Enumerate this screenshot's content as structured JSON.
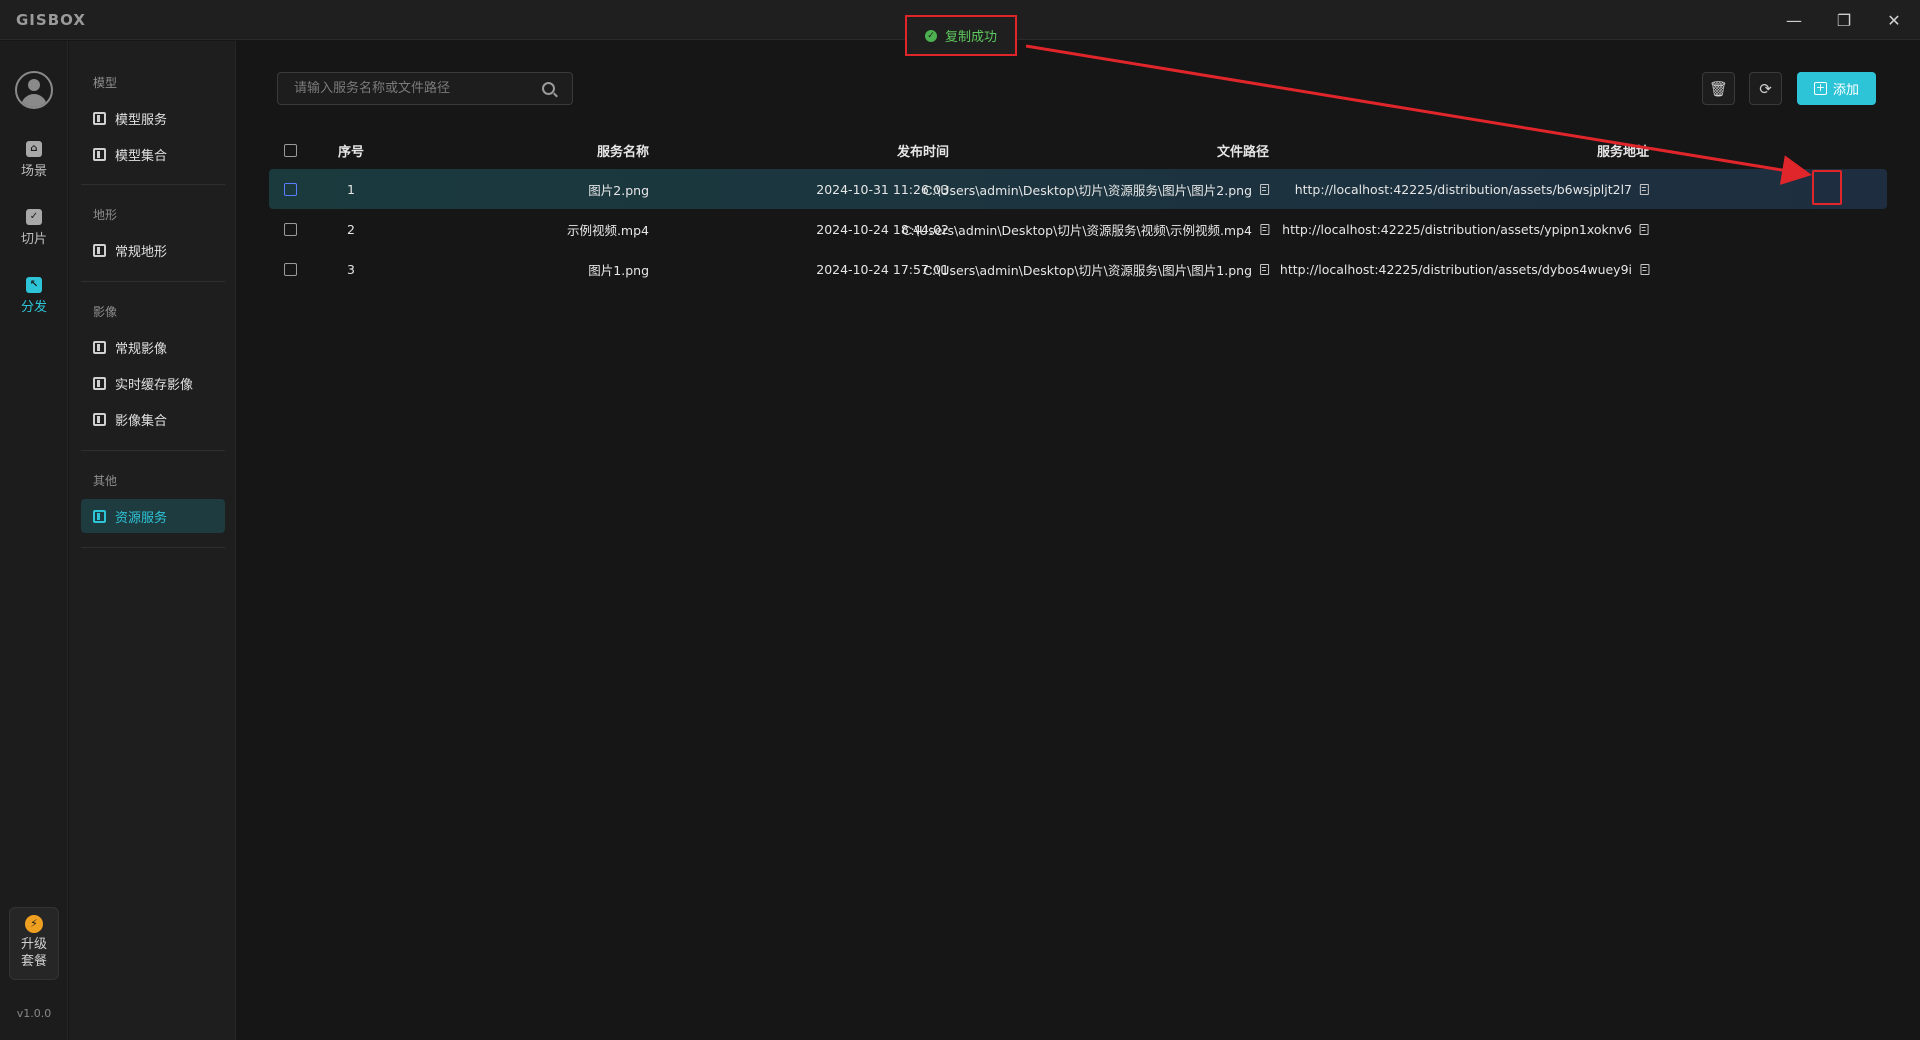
{
  "app": {
    "logo": "GISBOX"
  },
  "window_controls": {
    "minimize": "—",
    "maximize": "❐",
    "close": "✕"
  },
  "toast": {
    "text": "复制成功",
    "status_color": "#4caf50"
  },
  "rail": {
    "items": [
      {
        "label": "场景",
        "icon": "home-icon",
        "active": false
      },
      {
        "label": "切片",
        "icon": "check-square-icon",
        "active": false
      },
      {
        "label": "分发",
        "icon": "share-icon",
        "active": true
      }
    ],
    "upgrade": {
      "line1": "升级",
      "line2": "套餐"
    },
    "version": "v1.0.0"
  },
  "menu": {
    "sections": [
      {
        "title": "模型",
        "items": [
          {
            "label": "模型服务"
          },
          {
            "label": "模型集合"
          }
        ]
      },
      {
        "title": "地形",
        "items": [
          {
            "label": "常规地形"
          }
        ]
      },
      {
        "title": "影像",
        "items": [
          {
            "label": "常规影像"
          },
          {
            "label": "实时缓存影像"
          },
          {
            "label": "影像集合"
          }
        ]
      },
      {
        "title": "其他",
        "items": [
          {
            "label": "资源服务",
            "active": true
          }
        ]
      }
    ]
  },
  "toolbar": {
    "search_placeholder": "请输入服务名称或文件路径",
    "add_label": "添加",
    "delete_icon": "trash-icon",
    "refresh_icon": "refresh-icon"
  },
  "table": {
    "headers": {
      "no": "序号",
      "name": "服务名称",
      "time": "发布时间",
      "path": "文件路径",
      "url": "服务地址"
    },
    "rows": [
      {
        "no": "1",
        "name": "图片2.png",
        "time": "2024-10-31 11:26:03",
        "path": "C:\\Users\\admin\\Desktop\\切片\\资源服务\\图片\\图片2.png",
        "url": "http://localhost:42225/distribution/assets/b6wsjpljt2l7",
        "selected": true
      },
      {
        "no": "2",
        "name": "示例视频.mp4",
        "time": "2024-10-24 18:44:02",
        "path": "C:\\Users\\admin\\Desktop\\切片\\资源服务\\视频\\示例视频.mp4",
        "url": "http://localhost:42225/distribution/assets/ypipn1xoknv6",
        "selected": false
      },
      {
        "no": "3",
        "name": "图片1.png",
        "time": "2024-10-24 17:57:01",
        "path": "C:\\Users\\admin\\Desktop\\切片\\资源服务\\图片\\图片1.png",
        "url": "http://localhost:42225/distribution/assets/dybos4wuey9i",
        "selected": false
      }
    ]
  },
  "colors": {
    "accent": "#2ec4d8",
    "annotation_red": "#e0252b",
    "selected_row": "#1a3a3e"
  }
}
